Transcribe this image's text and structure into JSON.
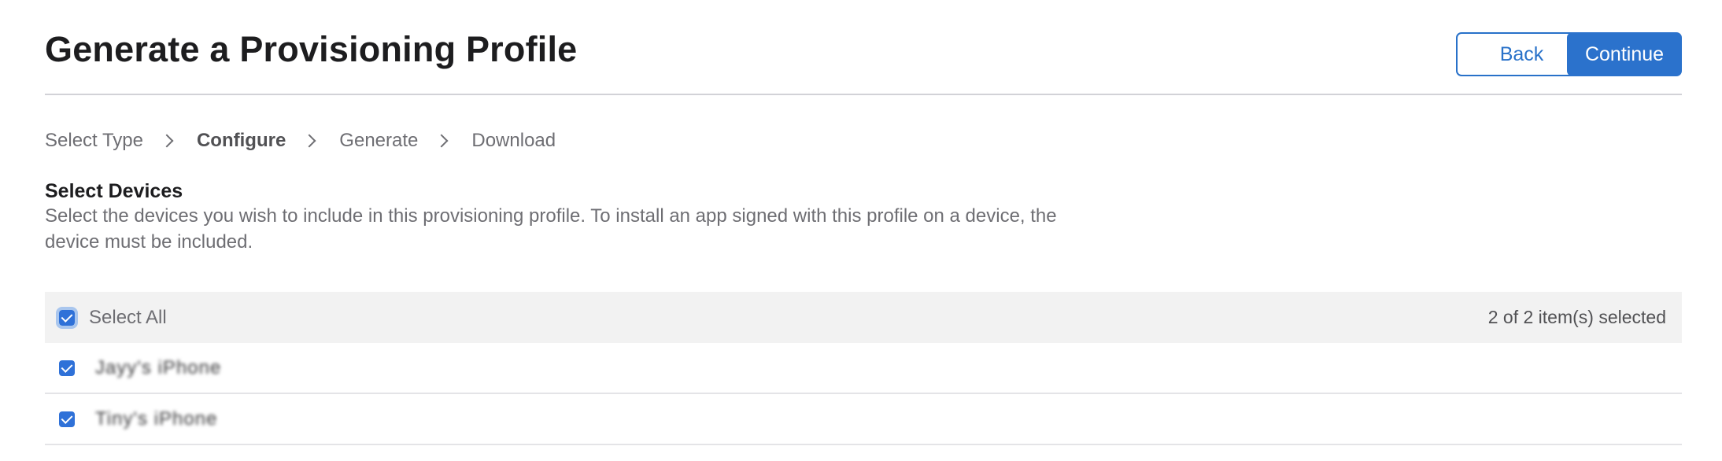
{
  "header": {
    "title": "Generate a Provisioning Profile",
    "back_label": "Back",
    "continue_label": "Continue"
  },
  "steps": [
    {
      "label": "Select Type",
      "active": false
    },
    {
      "label": "Configure",
      "active": true
    },
    {
      "label": "Generate",
      "active": false
    },
    {
      "label": "Download",
      "active": false
    }
  ],
  "section": {
    "title": "Select Devices",
    "description": "Select the devices you wish to include in this provisioning profile. To install an app signed with this profile on a device, the device must be included."
  },
  "devices": {
    "select_all_label": "Select All",
    "selection_count": "2 of 2 item(s) selected",
    "items": [
      {
        "name": "Jayy's iPhone",
        "checked": true
      },
      {
        "name": "Tiny's iPhone",
        "checked": true
      }
    ]
  },
  "colors": {
    "accent": "#2b72cc",
    "text_primary": "#1d1d1f",
    "text_secondary": "#6e6e73",
    "divider": "#d2d2d7",
    "table_header_bg": "#f2f2f2"
  }
}
